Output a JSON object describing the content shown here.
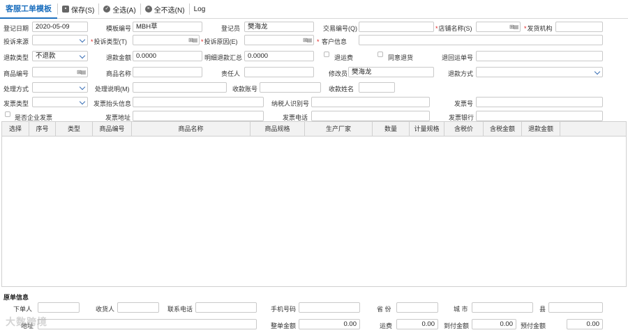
{
  "toolbar": {
    "title": "客服工单模板",
    "save": "保存(S)",
    "select_all": "全选(A)",
    "deselect_all": "全不选(N)",
    "log": "Log"
  },
  "form": {
    "reg_date_label": "登记日期",
    "reg_date": "2020-05-09",
    "template_no_label": "模板编号",
    "template_no": "MBH草",
    "registrar_label": "登记员",
    "registrar": "樊海龙",
    "trade_no_label": "交易编号(Q)",
    "trade_no": "",
    "shop_label": "店铺名称(S)",
    "shop": "",
    "ship_org_label": "发货机构",
    "ship_org": "",
    "complaint_src_label": "投诉来源",
    "complaint_src": "",
    "complaint_type_label": "投诉类型(T)",
    "complaint_type": "",
    "complaint_reason_label": "投诉原因(E)",
    "complaint_reason": "",
    "customer_label": "客户信息",
    "customer": "",
    "refund_type_label": "退款类型",
    "refund_type": "不退款",
    "refund_amount_label": "退款金额",
    "refund_amount": "0.0000",
    "detail_refund_label": "明细退款汇总",
    "detail_refund": "0.0000",
    "refund_freight_label": "退运费",
    "agree_return_label": "同意退货",
    "return_waybill_label": "退回运单号",
    "return_waybill": "",
    "goods_no_label": "商品编号",
    "goods_no": "",
    "goods_name_label": "商品名称",
    "goods_name": "",
    "owner_label": "责任人",
    "owner": "",
    "modifier_label": "修改员",
    "modifier": "樊海龙",
    "refund_method_label": "退款方式",
    "refund_method": "",
    "handle_method_label": "处理方式",
    "handle_method": "",
    "handle_desc_label": "处理说明(M)",
    "handle_desc": "",
    "receive_account_label": "收款账号",
    "receive_account": "",
    "receive_name_label": "收款姓名",
    "receive_name": "",
    "invoice_type_label": "发票类型",
    "invoice_type": "",
    "invoice_title_label": "发票抬头信息",
    "invoice_title": "",
    "taxpayer_id_label": "纳税人识别号",
    "taxpayer_id": "",
    "invoice_no_label": "发票号",
    "invoice_no": "",
    "enterprise_invoice_label": "是否企业发票",
    "invoice_addr_label": "发票地址",
    "invoice_addr": "",
    "invoice_phone_label": "发票电话",
    "invoice_phone": "",
    "invoice_bank_label": "发票银行",
    "invoice_bank": ""
  },
  "grid": {
    "columns": [
      "选择",
      "序号",
      "类型",
      "商品编号",
      "商品名称",
      "商品规格",
      "生产厂家",
      "数量",
      "计量规格",
      "含税价",
      "含税金额",
      "退款金额"
    ]
  },
  "original": {
    "title": "原单信息",
    "buyer_label": "下单人",
    "buyer": "",
    "receiver_label": "收货人",
    "receiver": "",
    "contact_phone_label": "联系电话",
    "contact_phone": "",
    "mobile_label": "手机号码",
    "mobile": "",
    "province_label": "省 份",
    "province": "",
    "city_label": "城 市",
    "city": "",
    "county_label": "县",
    "county": "",
    "address_label": "地址",
    "address": "",
    "order_amount_label": "整单金额",
    "order_amount": "0.00",
    "freight_label": "运费",
    "freight": "0.00",
    "cod_label": "到付金额",
    "cod": "0.00",
    "prepaid_label": "预付金额",
    "prepaid": "0.00"
  },
  "watermark": "大数跨境",
  "icons": {
    "save": "floppy-icon",
    "select_all": "check-circle-icon",
    "deselect_all": "x-circle-icon",
    "lookup": "lookup-icon"
  },
  "colors": {
    "accent": "#1c6fbe",
    "required": "#e02020"
  }
}
